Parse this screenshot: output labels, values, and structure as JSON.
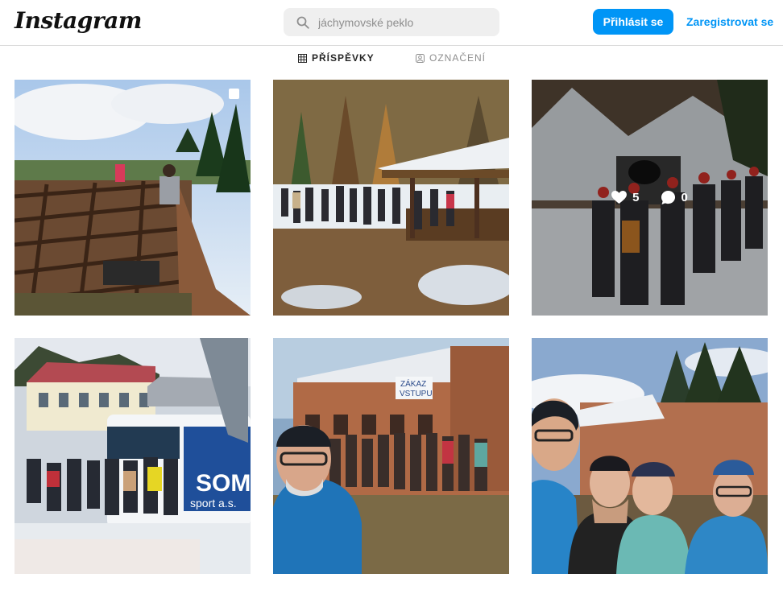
{
  "header": {
    "logo": "Instagram",
    "search_placeholder": "jáchymovské peklo",
    "login_label": "Přihlásit se",
    "signup_label": "Zaregistrovat se",
    "accent_color": "#0095f6"
  },
  "tabs": [
    {
      "label": "PŘÍSPĚVKY",
      "icon": "grid-icon",
      "active": true
    },
    {
      "label": "OZNAČENÍ",
      "icon": "tag-user-icon",
      "active": false
    }
  ],
  "posts": [
    {
      "scene": "rooftop ruins with visitors",
      "multiple": true
    },
    {
      "scene": "group at forest shelter in snow"
    },
    {
      "scene": "group entering mine tunnel in snow",
      "likes": "5",
      "comments": "0",
      "hovered": true
    },
    {
      "scene": "group by bus near school building",
      "bus_text": "SOM",
      "bus_subtext": "sport a.s."
    },
    {
      "scene": "group selfie at ruined brick building",
      "sign_text_1": "ZÁKAZ",
      "sign_text_2": "VSTUPU"
    },
    {
      "scene": "close-up selfie of four people at ruins"
    }
  ]
}
